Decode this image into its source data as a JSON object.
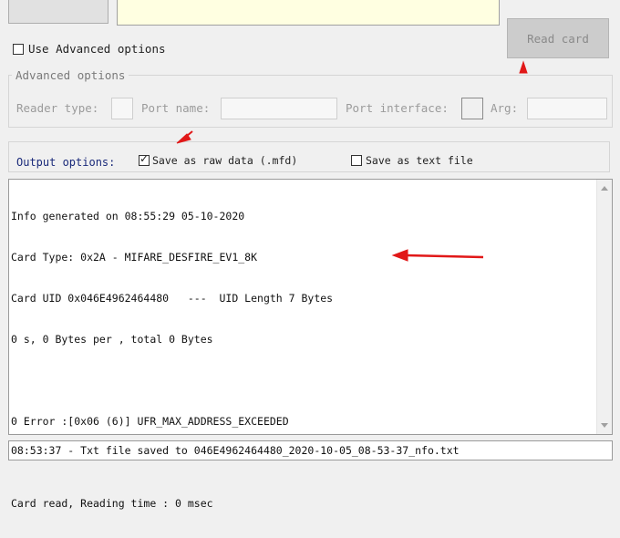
{
  "header": {
    "top_button_label": "",
    "info_box_text": ""
  },
  "options": {
    "use_advanced_label": "Use Advanced options",
    "use_advanced_checked": false,
    "read_card_label": "Read card"
  },
  "advanced": {
    "legend": "Advanced options",
    "reader_type_label": "Reader type:",
    "port_name_label": "Port name:",
    "port_interface_label": "Port interface:",
    "arg_label": "Arg:"
  },
  "output": {
    "label": "Output options:",
    "save_raw_label": "Save as raw data (.mfd)",
    "save_raw_checked": true,
    "save_text_label": "Save as text file",
    "save_text_checked": false
  },
  "log": {
    "lines": [
      "Info generated on 08:55:29 05-10-2020",
      "Card Type: 0x2A - MIFARE_DESFIRE_EV1_8K",
      "Card UID 0x046E4962464480   ---  UID Length 7 Bytes",
      "0 s, 0 Bytes per , total 0 Bytes",
      "",
      "0 Error :[0x06 (6)] UFR_MAX_ADDRESS_EXCEEDED",
      "",
      "Card read, Reading time : 0 msec"
    ]
  },
  "status": {
    "text": "08:53:37 - Txt file saved to 046E4962464480_2020-10-05_08-53-37_nfo.txt"
  },
  "annotations": {
    "arrow_color": "#e11818"
  }
}
